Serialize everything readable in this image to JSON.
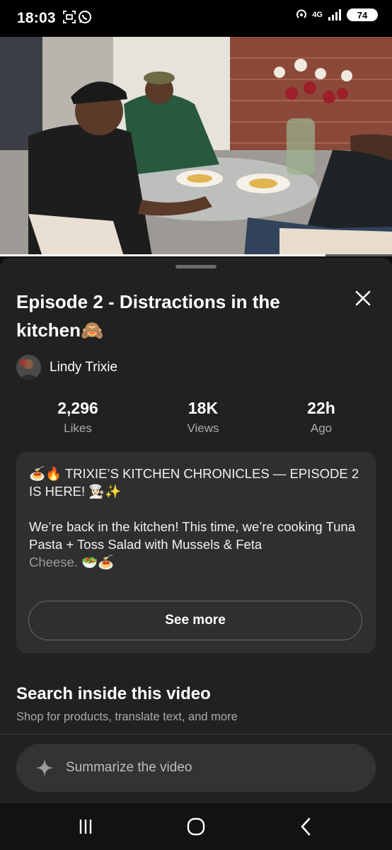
{
  "status_bar": {
    "time": "18:03",
    "network": "4G",
    "battery": "74",
    "icons": [
      "screenshot-icon",
      "whatsapp-icon",
      "hotspot-icon",
      "signal-icon",
      "battery-icon"
    ]
  },
  "video": {
    "progress_fraction": 0.83
  },
  "details": {
    "title": "Episode 2 - Distractions in the kitchen🙈",
    "channel": "Lindy Trixie",
    "stats": [
      {
        "value": "2,296",
        "label": "Likes"
      },
      {
        "value": "18K",
        "label": "Views"
      },
      {
        "value": "22h",
        "label": "Ago"
      }
    ],
    "description": {
      "line1": "🍝🔥 TRIXIE’S KITCHEN CHRONICLES — EPISODE 2 IS HERE! 👩🏻‍🍳✨",
      "line2a": "We’re back in the kitchen! This time, we’re cooking Tuna Pasta + Toss Salad with Mussels & Feta",
      "line2b": "Cheese. 🥗🍝"
    },
    "see_more": "See more"
  },
  "search": {
    "title": "Search inside this video",
    "subtitle": "Shop for products, translate text, and more",
    "summarize": "Summarize the video"
  },
  "colors": {
    "background": "#0f0f0f",
    "sheet": "#212121",
    "card": "#2f2f2f",
    "secondary_text": "#aaaaaa"
  }
}
